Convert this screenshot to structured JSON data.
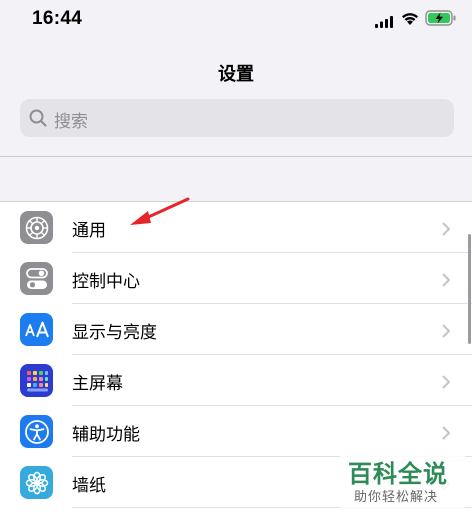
{
  "status_bar": {
    "time": "16:44",
    "icons": [
      "signal-icon",
      "wifi-icon",
      "battery-charging-icon"
    ]
  },
  "header": {
    "title": "设置"
  },
  "search": {
    "placeholder": "搜索"
  },
  "settings": {
    "items": [
      {
        "label": "通用",
        "icon": "gear-icon",
        "icon_bg": "#8e8e93"
      },
      {
        "label": "控制中心",
        "icon": "toggles-icon",
        "icon_bg": "#8e8e93"
      },
      {
        "label": "显示与亮度",
        "icon": "text-size-icon",
        "icon_bg": "#1c7cf0"
      },
      {
        "label": "主屏幕",
        "icon": "home-grid-icon",
        "icon_bg": "#2b3ccf"
      },
      {
        "label": "辅助功能",
        "icon": "accessibility-icon",
        "icon_bg": "#1e7bef"
      },
      {
        "label": "墙纸",
        "icon": "wallpaper-flower-icon",
        "icon_bg": "#36aadc"
      }
    ]
  },
  "annotation": {
    "color": "#e5252a",
    "points_to": "通用"
  },
  "watermark": {
    "title": "百科全说",
    "subtitle": "助你轻松解决",
    "color": "#2e8b57"
  }
}
